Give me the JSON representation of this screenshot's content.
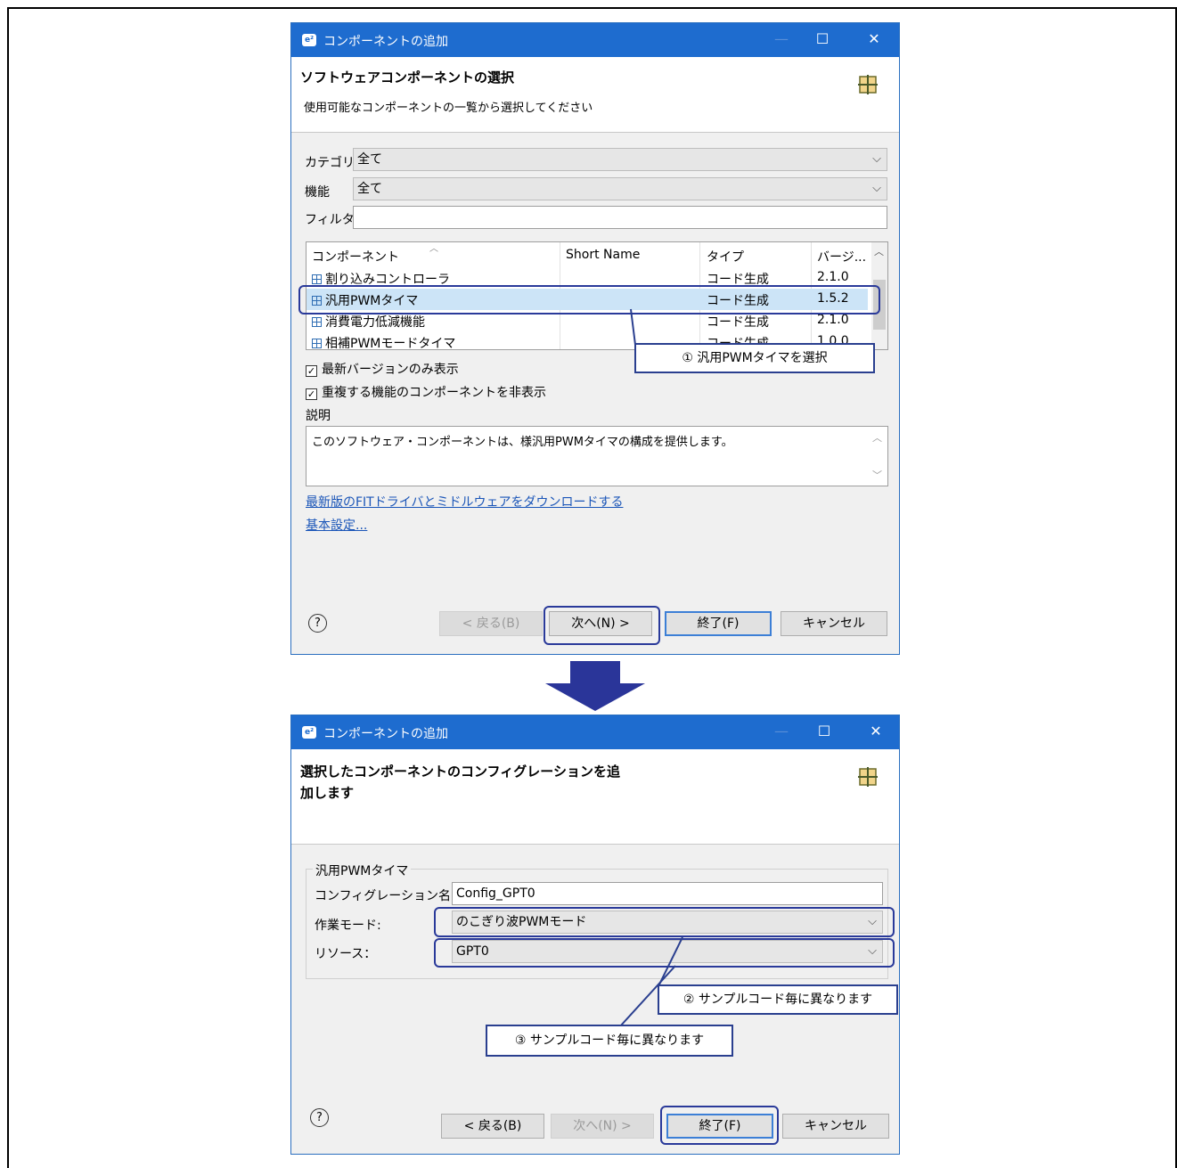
{
  "dialog1": {
    "title": "コンポーネントの追加",
    "header_title": "ソフトウェアコンポーネントの選択",
    "header_subtitle": "使用可能なコンポーネントの一覧から選択してください",
    "category_label": "カテゴリ",
    "category_value": "全て",
    "function_label": "機能",
    "function_value": "全て",
    "filter_label": "フィルタ",
    "filter_value": "",
    "table": {
      "columns": [
        "コンポーネント",
        "Short Name",
        "タイプ",
        "バージ..."
      ],
      "rows": [
        {
          "name": "割り込みコントローラ",
          "short": "",
          "type": "コード生成",
          "version": "2.1.0"
        },
        {
          "name": "汎用PWMタイマ",
          "short": "",
          "type": "コード生成",
          "version": "1.5.2"
        },
        {
          "name": "消費電力低減機能",
          "short": "",
          "type": "コード生成",
          "version": "2.1.0"
        },
        {
          "name": "相補PWMモードタイマ",
          "short": "",
          "type": "コード生成",
          "version": "1.0.0"
        }
      ],
      "selected_index": 1
    },
    "checkbox_latest": "最新バージョンのみ表示",
    "checkbox_duplicate": "重複する機能のコンポーネントを非表示",
    "description_label": "説明",
    "description_text": "このソフトウェア・コンポーネントは、様汎用PWMタイマの構成を提供します。",
    "link_download": "最新版のFITドライバとミドルウェアをダウンロードする",
    "link_settings": "基本設定...",
    "buttons": {
      "back": "< 戻る(B)",
      "next": "次へ(N) >",
      "finish": "終了(F)",
      "cancel": "キャンセル"
    },
    "callout": "① 汎用PWMタイマを選択"
  },
  "dialog2": {
    "title": "コンポーネントの追加",
    "header_title_line1": "選択したコンポーネントのコンフィグレーションを追",
    "header_title_line2": "加します",
    "group_label": "汎用PWMタイマ",
    "config_name_label": "コンフィグレーション名：",
    "config_name_value": "Config_GPT0",
    "work_mode_label": "作業モード:",
    "work_mode_value": "のこぎり波PWMモード",
    "resource_label": "リソース：",
    "resource_value": "GPT0",
    "buttons": {
      "back": "< 戻る(B)",
      "next": "次へ(N) >",
      "finish": "終了(F)",
      "cancel": "キャンセル"
    },
    "callout2": "② サンプルコード毎に異なります",
    "callout3": "③ サンプルコード毎に異なります"
  },
  "colors": {
    "titlebar": "#1e6ccf",
    "annotation": "#2a3a9a",
    "arrow": "#2a3599",
    "selection": "#cce4f7"
  }
}
